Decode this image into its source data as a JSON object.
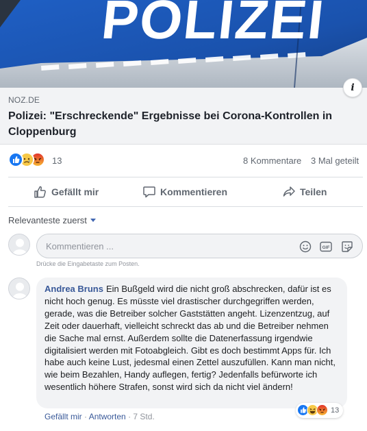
{
  "preview": {
    "image_text": "POLIZEI",
    "info_label": "i",
    "domain": "NOZ.DE",
    "headline": "Polizei: \"Erschreckende\" Ergebnisse bei Corona-Kontrollen in Cloppenburg"
  },
  "reactions": {
    "types": [
      "like",
      "sad",
      "angry"
    ],
    "count": "13",
    "comments": "8 Kommentare",
    "shares": "3 Mal geteilt"
  },
  "actions": {
    "like": "Gefällt mir",
    "comment": "Kommentieren",
    "share": "Teilen"
  },
  "sort": {
    "label": "Relevanteste zuerst"
  },
  "composer": {
    "placeholder": "Kommentieren ...",
    "hint": "Drücke die Eingabetaste zum Posten.",
    "tools": [
      "emoji-icon",
      "gif-icon",
      "sticker-icon"
    ]
  },
  "comment": {
    "author": "Andrea Bruns",
    "text": "Ein Bußgeld wird die nicht groß abschrecken, dafür ist es nicht hoch genug. Es müsste viel drastischer durchgegriffen werden, gerade, was die Betreiber solcher Gaststätten angeht. Lizenzentzug, auf Zeit oder dauerhaft, vielleicht schreckt das ab und die Betreiber nehmen die Sache mal ernst. Außerdem sollte die Datenerfassung irgendwie digitalisiert werden mit Fotoabgleich. Gibt es doch bestimmt Apps für. Ich habe auch keine Lust, jedesmal einen Zettel auszufüllen. Kann man nicht, wie beim Bezahlen, Handy auflegen, fertig? Jedenfalls befürworte ich wesentlich höhere Strafen, sonst wird sich da nicht viel ändern!",
    "reaction_types": [
      "like",
      "haha",
      "angry"
    ],
    "reaction_count": "13",
    "like_label": "Gefällt mir",
    "sep1": "·",
    "reply_label": "Antworten",
    "sep2": "·",
    "time": "7 Std."
  },
  "colors": {
    "link_blue": "#385898",
    "like_blue": "#1877f2",
    "angry_red": "#e9710f",
    "police_blue": "#1a56b8"
  }
}
